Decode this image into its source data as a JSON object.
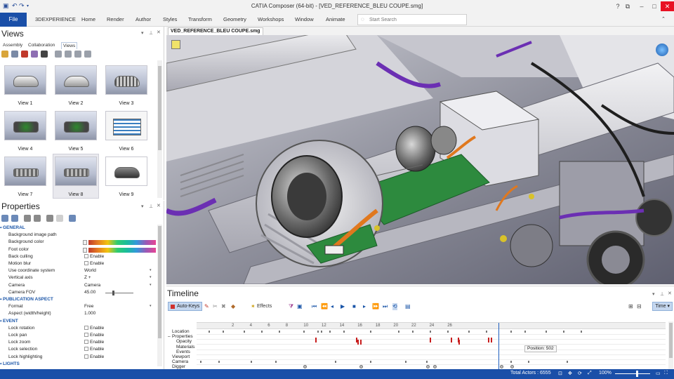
{
  "window": {
    "title": "CATIA Composer (64-bit) - [VED_REFERENCE_BLEU COUPE.smg]",
    "quick_access_icons": [
      "save-icon",
      "undo-icon",
      "redo-icon",
      "dropdown-icon"
    ],
    "controls": {
      "help": "?",
      "restore": "⧉",
      "minimize": "–",
      "maximize": "□",
      "close": "✕"
    }
  },
  "ribbon": {
    "file_label": "File",
    "tabs": [
      "3DEXPERIENCE",
      "Home",
      "Render",
      "Author",
      "Styles",
      "Transform",
      "Geometry",
      "Workshops",
      "Window",
      "Animate"
    ],
    "search_placeholder": "Start Search"
  },
  "views_panel": {
    "title": "Views",
    "tabs": [
      "Assembly",
      "Collaboration",
      "Views"
    ],
    "active_tab": "Views",
    "views": [
      "View 1",
      "View 2",
      "View 3",
      "View 4",
      "View 5",
      "View 6",
      "View 7",
      "View 8",
      "View 9"
    ],
    "selected_view": "View 8"
  },
  "properties_panel": {
    "title": "Properties",
    "rows": [
      {
        "type": "section",
        "label": "GENERAL"
      },
      {
        "type": "text",
        "label": "Background image path",
        "value": ""
      },
      {
        "type": "color",
        "label": "Background color"
      },
      {
        "type": "color",
        "label": "Foot color"
      },
      {
        "type": "check",
        "label": "Back culling",
        "value": "Enable"
      },
      {
        "type": "check",
        "label": "Motion blur",
        "value": "Enable"
      },
      {
        "type": "select",
        "label": "Use coordinate system",
        "value": "World"
      },
      {
        "type": "select",
        "label": "Vertical axis",
        "value": "Z +"
      },
      {
        "type": "select",
        "label": "Camera",
        "value": "Camera"
      },
      {
        "type": "slider",
        "label": "Camera FOV",
        "value": "45.00"
      },
      {
        "type": "section",
        "label": "PUBLICATION ASPECT"
      },
      {
        "type": "select",
        "label": "Format",
        "value": "Free"
      },
      {
        "type": "text",
        "label": "Aspect (width/height)",
        "value": "1.000"
      },
      {
        "type": "section",
        "label": "EVENT"
      },
      {
        "type": "check",
        "label": "Lock rotation",
        "value": "Enable"
      },
      {
        "type": "check",
        "label": "Lock pan",
        "value": "Enable"
      },
      {
        "type": "check",
        "label": "Lock zoom",
        "value": "Enable"
      },
      {
        "type": "check",
        "label": "Lock selection",
        "value": "Enable"
      },
      {
        "type": "check",
        "label": "Lock highlighting",
        "value": "Enable"
      },
      {
        "type": "section",
        "label": "LIGHTS"
      }
    ]
  },
  "viewport": {
    "document_tab": "VED_REFERENCE_BLEU COUPE.smg"
  },
  "timeline": {
    "title": "Timeline",
    "auto_keys_label": "Auto-Keys",
    "effects_label": "Effects",
    "time_mode_label": "Time",
    "ruler_ticks": [
      "2",
      "4",
      "6",
      "8",
      "10",
      "12",
      "14",
      "16",
      "18",
      "20",
      "22",
      "24",
      "26"
    ],
    "tracks": [
      {
        "label": "Location",
        "sub": false
      },
      {
        "label": "Properties",
        "sub": false,
        "expander": "–"
      },
      {
        "label": "Opacity",
        "sub": true
      },
      {
        "label": "Materials",
        "sub": true
      },
      {
        "label": "Events",
        "sub": true
      },
      {
        "label": "Viewport",
        "sub": false
      },
      {
        "label": "Camera",
        "sub": false
      },
      {
        "label": "Digger",
        "sub": false
      }
    ],
    "position_tooltip": "Position: 502"
  },
  "status_bar": {
    "total_actors": "Total Actors : 6555",
    "zoom": "100%"
  },
  "colors": {
    "accent": "#1a4fa8",
    "selection_blue": "#c5d7ef",
    "keyframe_red": "#c81e1e",
    "close_red": "#e81123"
  }
}
